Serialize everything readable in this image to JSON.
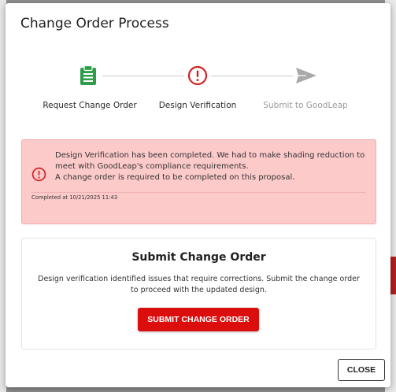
{
  "modal": {
    "title": "Change Order Process"
  },
  "stepper": {
    "steps": [
      {
        "label": "Request Change Order",
        "icon": "clipboard-icon",
        "status": "complete",
        "color": "#2e9e4a"
      },
      {
        "label": "Design Verification",
        "icon": "alert-circle-icon",
        "status": "error",
        "color": "#d32222"
      },
      {
        "label": "Submit to GoodLeap",
        "icon": "send-icon",
        "status": "pending",
        "color": "#a9a9a9"
      }
    ]
  },
  "alert": {
    "message_line1": "Design Verification has been completed. We had to make shading reduction to meet with GoodLeap's compliance requirements.",
    "message_line2": "A change order is required to be completed on this proposal.",
    "completed": "Completed at 10/21/2025 11:43",
    "background": "#fdcaca",
    "icon_color": "#d32222"
  },
  "card": {
    "title": "Submit Change Order",
    "description": "Design verification identified issues that require corrections. Submit the change order to proceed with the updated design.",
    "button_label": "SUBMIT CHANGE ORDER",
    "button_color": "#db0d0d"
  },
  "footer": {
    "close_label": "CLOSE"
  }
}
